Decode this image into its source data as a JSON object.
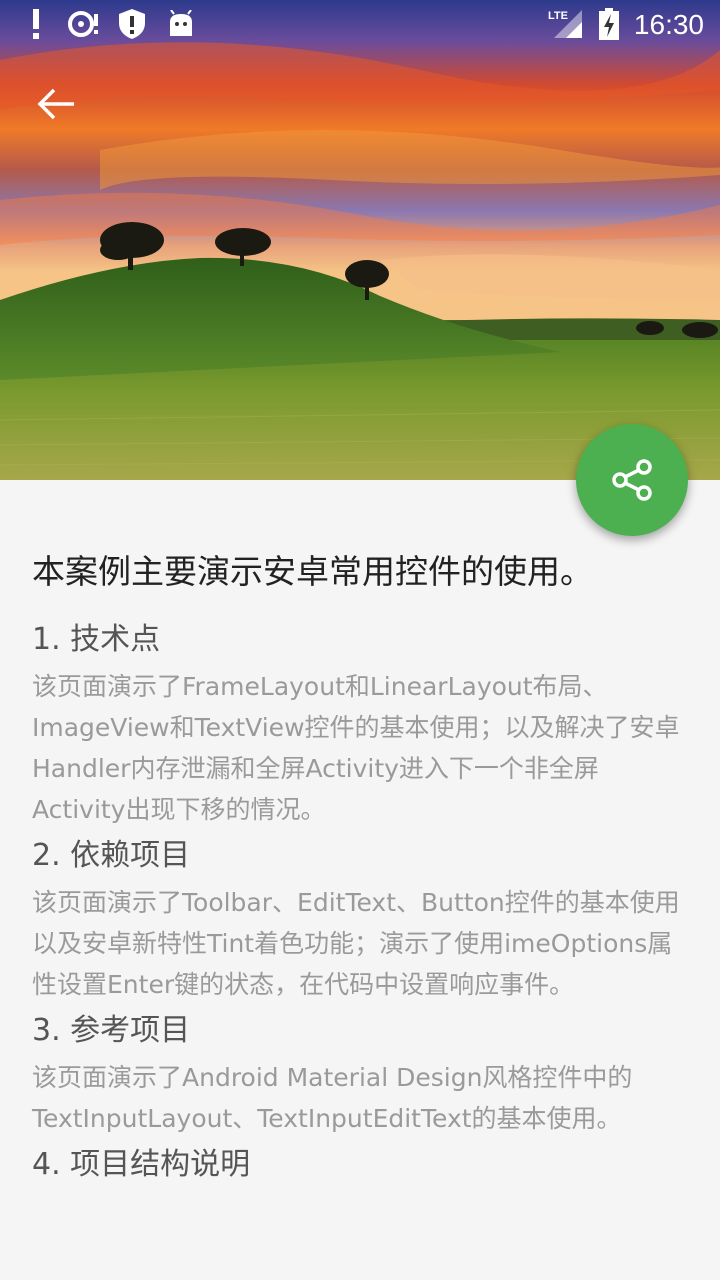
{
  "status_bar": {
    "time": "16:30",
    "network": "LTE",
    "icons": [
      "alert-icon",
      "sd-card-icon",
      "shield-icon",
      "android-icon",
      "lte-signal-icon",
      "battery-charging-icon"
    ]
  },
  "toolbar": {
    "back_icon": "arrow-back-icon"
  },
  "fab": {
    "icon": "share-icon",
    "color": "#4caf50"
  },
  "content": {
    "title": "本案例主要演示安卓常用控件的使用。",
    "sections": [
      {
        "heading": "1. 技术点",
        "body": "该页面演示了FrameLayout和LinearLayout布局、ImageView和TextView控件的基本使用；以及解决了安卓Handler内存泄漏和全屏Activity进入下一个非全屏Activity出现下移的情况。"
      },
      {
        "heading": "2. 依赖项目",
        "body": "该页面演示了Toolbar、EditText、Button控件的基本使用以及安卓新特性Tint着色功能；演示了使用imeOptions属性设置Enter键的状态，在代码中设置响应事件。"
      },
      {
        "heading": "3. 参考项目",
        "body": "该页面演示了Android Material Design风格控件中的TextInputLayout、TextInputEditText的基本使用。"
      },
      {
        "heading": "4. 项目结构说明",
        "body": ""
      }
    ]
  }
}
